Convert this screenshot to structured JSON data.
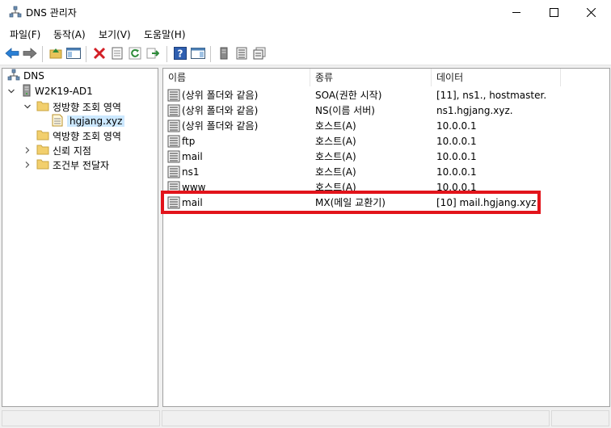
{
  "window": {
    "title": "DNS 관리자",
    "icon": "dns-manager-icon"
  },
  "menu": {
    "items": [
      {
        "label": "파일(F)"
      },
      {
        "label": "동작(A)"
      },
      {
        "label": "보기(V)"
      },
      {
        "label": "도움말(H)"
      }
    ]
  },
  "toolbar": {
    "buttons": [
      "back",
      "forward",
      "up-folder",
      "show-hide-console-tree",
      "delete",
      "properties",
      "refresh",
      "export-list",
      "help",
      "show-action-pane",
      "server",
      "records-list",
      "copy-records"
    ]
  },
  "tree": {
    "root": "DNS",
    "server": "W2K19-AD1",
    "forward_zones": "정방향 조회 영역",
    "zone": "hgjang.xyz",
    "reverse_zones": "역방향 조회 영역",
    "trust_points": "신뢰 지점",
    "conditional_forwarders": "조건부 전달자"
  },
  "list": {
    "columns": [
      "이름",
      "종류",
      "데이터"
    ],
    "rows": [
      {
        "name": "(상위 폴더와 같음)",
        "type": "SOA(권한 시작)",
        "data": "[11], ns1., hostmaster."
      },
      {
        "name": "(상위 폴더와 같음)",
        "type": "NS(이름 서버)",
        "data": "ns1.hgjang.xyz."
      },
      {
        "name": "(상위 폴더와 같음)",
        "type": "호스트(A)",
        "data": "10.0.0.1"
      },
      {
        "name": "ftp",
        "type": "호스트(A)",
        "data": "10.0.0.1"
      },
      {
        "name": "mail",
        "type": "호스트(A)",
        "data": "10.0.0.1"
      },
      {
        "name": "ns1",
        "type": "호스트(A)",
        "data": "10.0.0.1"
      },
      {
        "name": "www",
        "type": "호스트(A)",
        "data": "10.0.0.1"
      },
      {
        "name": "mail",
        "type": "MX(메일 교환기)",
        "data": "[10]  mail.hgjang.xyz"
      }
    ],
    "highlighted_row": 7,
    "highlight_color": "#e2141b"
  }
}
